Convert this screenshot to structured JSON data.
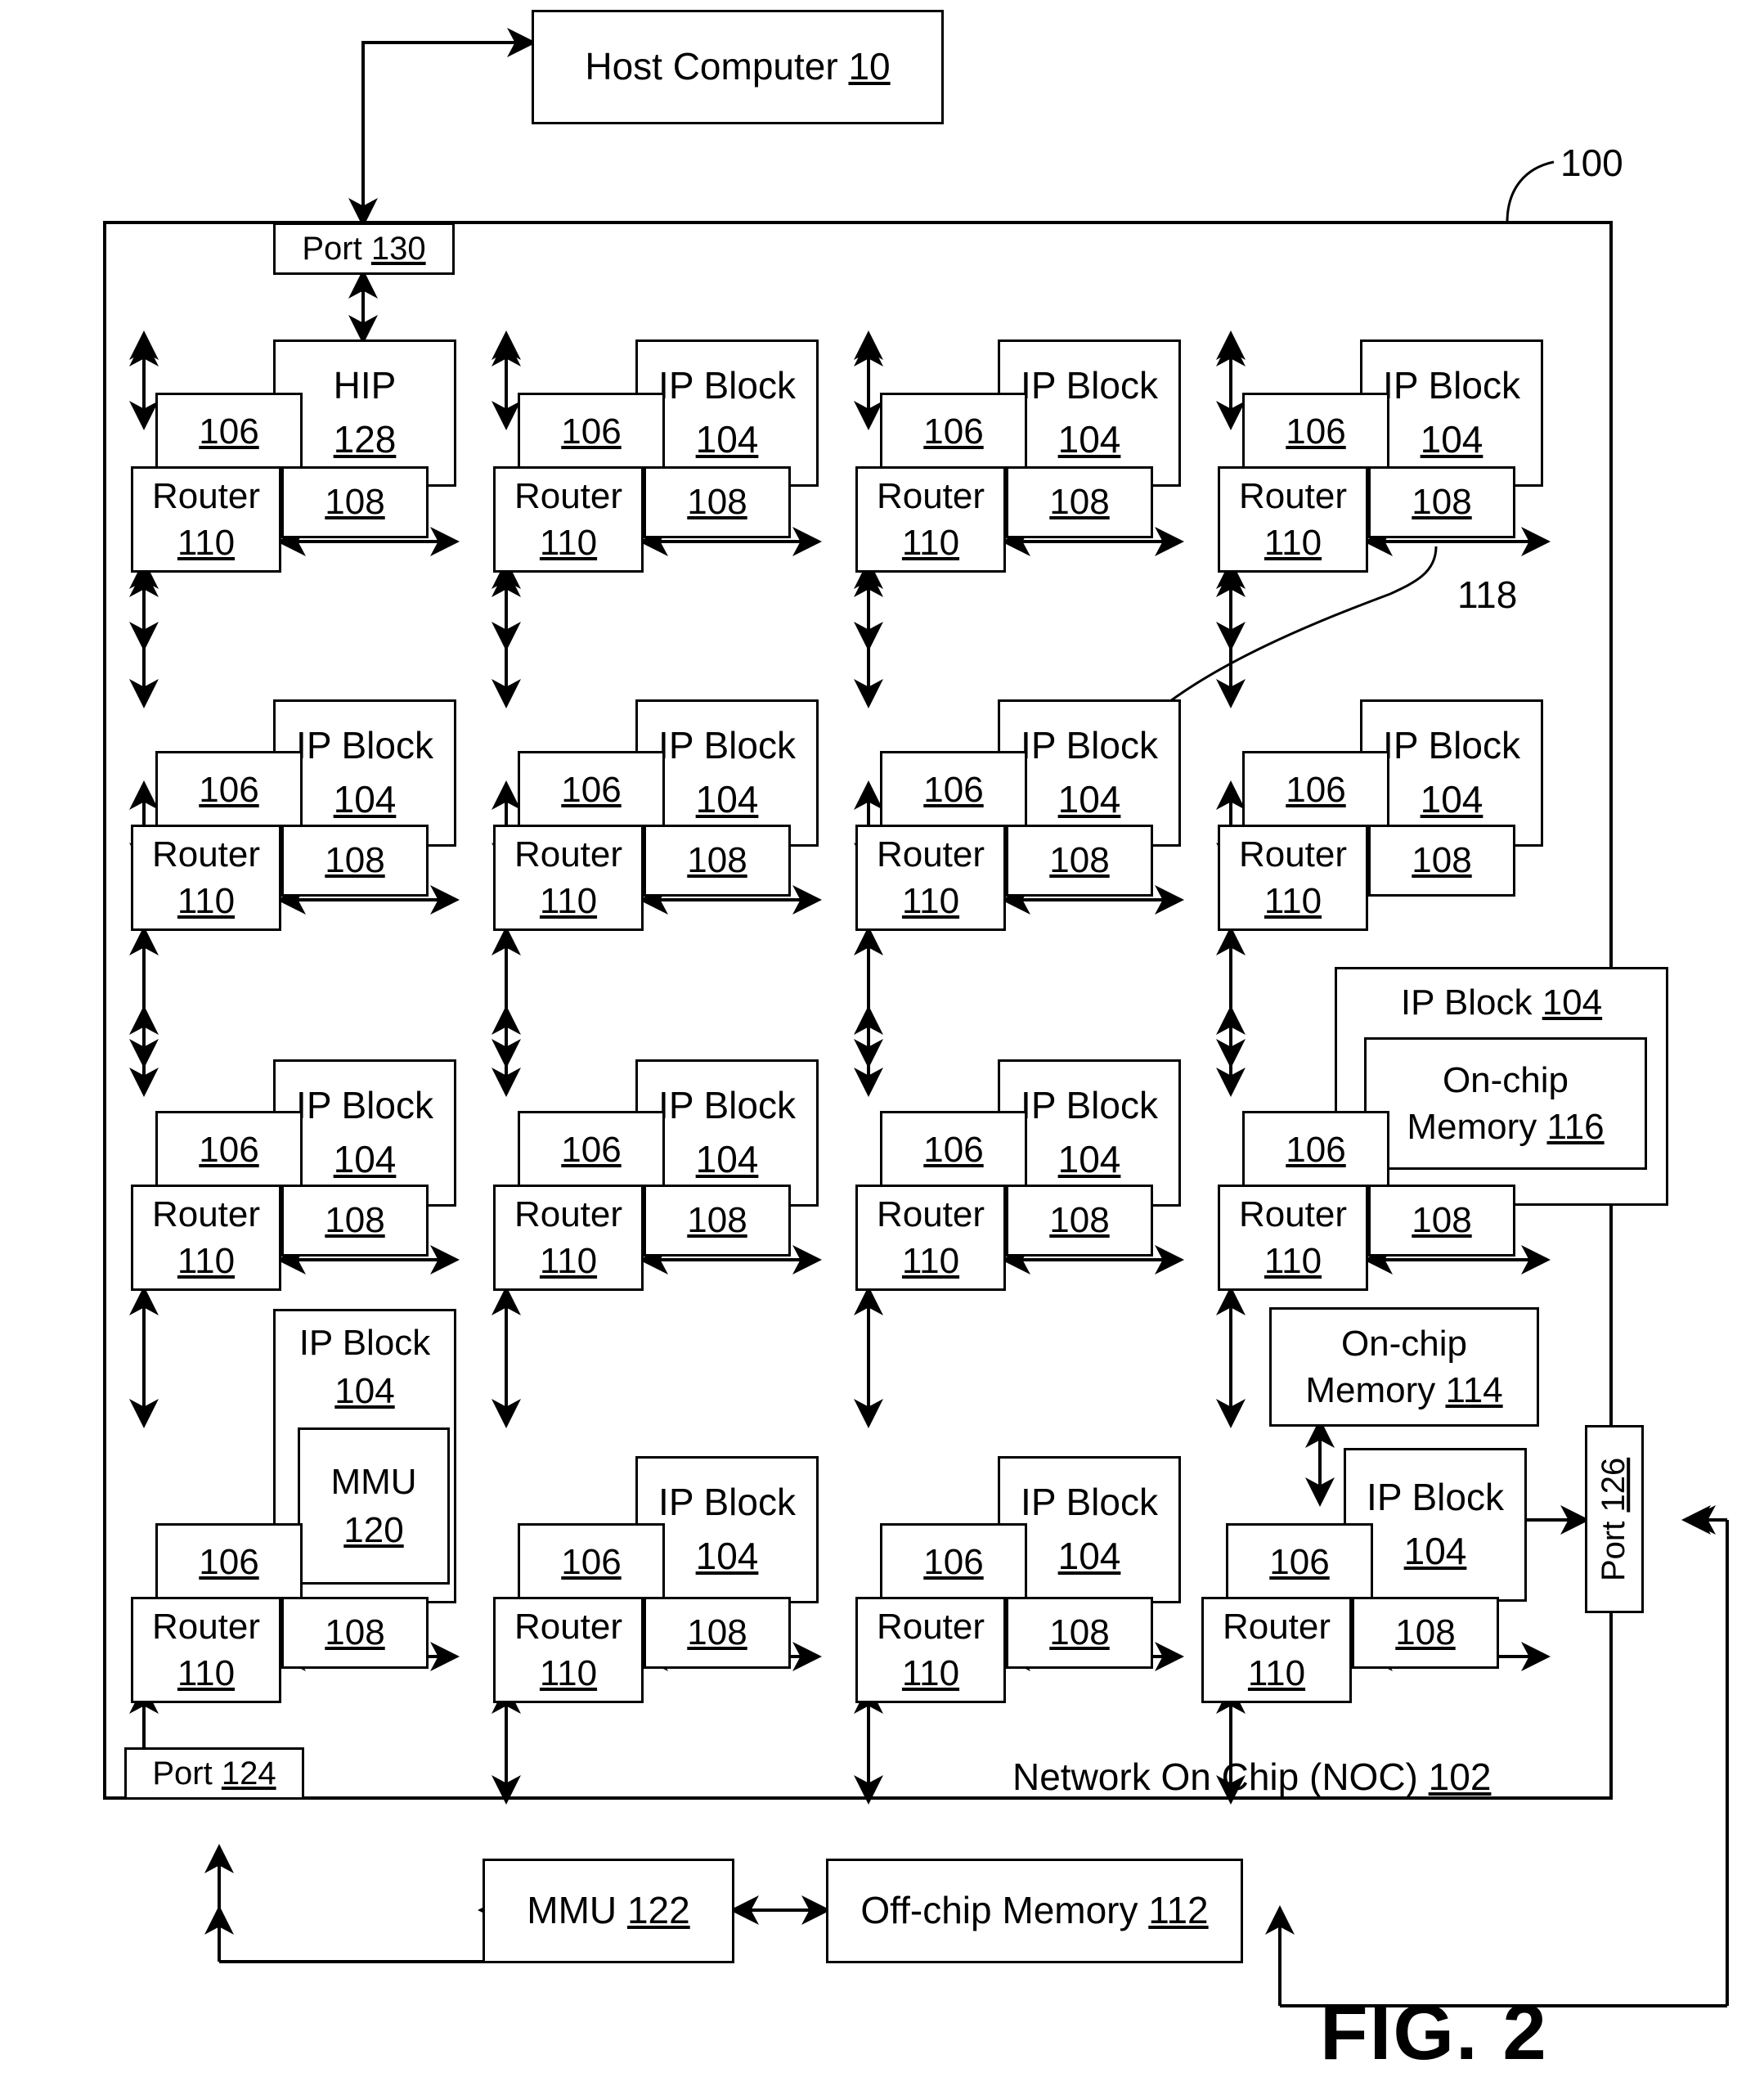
{
  "figure": {
    "label": "FIG. 2",
    "system_ref": "100"
  },
  "host": {
    "name": "Host Computer",
    "ref": "10"
  },
  "noc": {
    "title": "Network On Chip (NOC)",
    "ref": "102",
    "link_ref": "118"
  },
  "ports": {
    "top": {
      "name": "Port",
      "ref": "130"
    },
    "bottom_left": {
      "name": "Port",
      "ref": "124"
    },
    "right": {
      "name": "Port",
      "ref": "126"
    }
  },
  "cell_parts": {
    "memory_comm_controller_ref": "106",
    "network_interface_controller_ref": "108",
    "router_name": "Router",
    "router_ref": "110"
  },
  "grid": {
    "rows": [
      [
        {
          "kind": "hip",
          "top_label": "HIP",
          "top_ref": "128",
          "nic": "108",
          "mcc": "106",
          "router": "Router",
          "router_ref": "110"
        },
        {
          "kind": "ipblock",
          "top_label": "IP Block",
          "top_ref": "104",
          "nic": "108",
          "mcc": "106",
          "router": "Router",
          "router_ref": "110"
        },
        {
          "kind": "ipblock",
          "top_label": "IP Block",
          "top_ref": "104",
          "nic": "108",
          "mcc": "106",
          "router": "Router",
          "router_ref": "110"
        },
        {
          "kind": "ipblock",
          "top_label": "IP Block",
          "top_ref": "104",
          "nic": "108",
          "mcc": "106",
          "router": "Router",
          "router_ref": "110"
        }
      ],
      [
        {
          "kind": "ipblock",
          "top_label": "IP Block",
          "top_ref": "104",
          "nic": "108",
          "mcc": "106",
          "router": "Router",
          "router_ref": "110"
        },
        {
          "kind": "ipblock",
          "top_label": "IP Block",
          "top_ref": "104",
          "nic": "108",
          "mcc": "106",
          "router": "Router",
          "router_ref": "110"
        },
        {
          "kind": "ipblock",
          "top_label": "IP Block",
          "top_ref": "104",
          "nic": "108",
          "mcc": "106",
          "router": "Router",
          "router_ref": "110"
        },
        {
          "kind": "ipblock",
          "top_label": "IP Block",
          "top_ref": "104",
          "nic": "108",
          "mcc": "106",
          "router": "Router",
          "router_ref": "110"
        }
      ],
      [
        {
          "kind": "ipblock",
          "top_label": "IP Block",
          "top_ref": "104",
          "nic": "108",
          "mcc": "106",
          "router": "Router",
          "router_ref": "110"
        },
        {
          "kind": "ipblock",
          "top_label": "IP Block",
          "top_ref": "104",
          "nic": "108",
          "mcc": "106",
          "router": "Router",
          "router_ref": "110"
        },
        {
          "kind": "ipblock",
          "top_label": "IP Block",
          "top_ref": "104",
          "nic": "108",
          "mcc": "106",
          "router": "Router",
          "router_ref": "110"
        },
        {
          "kind": "ipblock_mem",
          "top_label": "IP Block",
          "top_ref": "104",
          "inner_line1": "On-chip",
          "inner_line2": "Memory",
          "inner_ref": "116",
          "nic": "108",
          "mcc": "106",
          "router": "Router",
          "router_ref": "110"
        }
      ],
      [
        {
          "kind": "ipblock_mmu",
          "top_label": "IP Block",
          "top_ref": "104",
          "inner_line1": "MMU",
          "inner_ref": "120",
          "nic": "108",
          "mcc": "106",
          "router": "Router",
          "router_ref": "110"
        },
        {
          "kind": "ipblock",
          "top_label": "IP Block",
          "top_ref": "104",
          "nic": "108",
          "mcc": "106",
          "router": "Router",
          "router_ref": "110"
        },
        {
          "kind": "ipblock",
          "top_label": "IP Block",
          "top_ref": "104",
          "nic": "108",
          "mcc": "106",
          "router": "Router",
          "router_ref": "110"
        },
        {
          "kind": "ipblock",
          "top_label": "IP Block",
          "top_ref": "104",
          "nic": "108",
          "mcc": "106",
          "router": "Router",
          "router_ref": "110"
        }
      ]
    ]
  },
  "onchip_memory_114": {
    "line1": "On-chip",
    "line2": "Memory",
    "ref": "114"
  },
  "offchip": {
    "mmu": {
      "name": "MMU",
      "ref": "122"
    },
    "memory": {
      "name": "Off-chip  Memory",
      "ref": "112"
    }
  },
  "colors": {
    "stroke": "#000000",
    "background": "#ffffff"
  }
}
